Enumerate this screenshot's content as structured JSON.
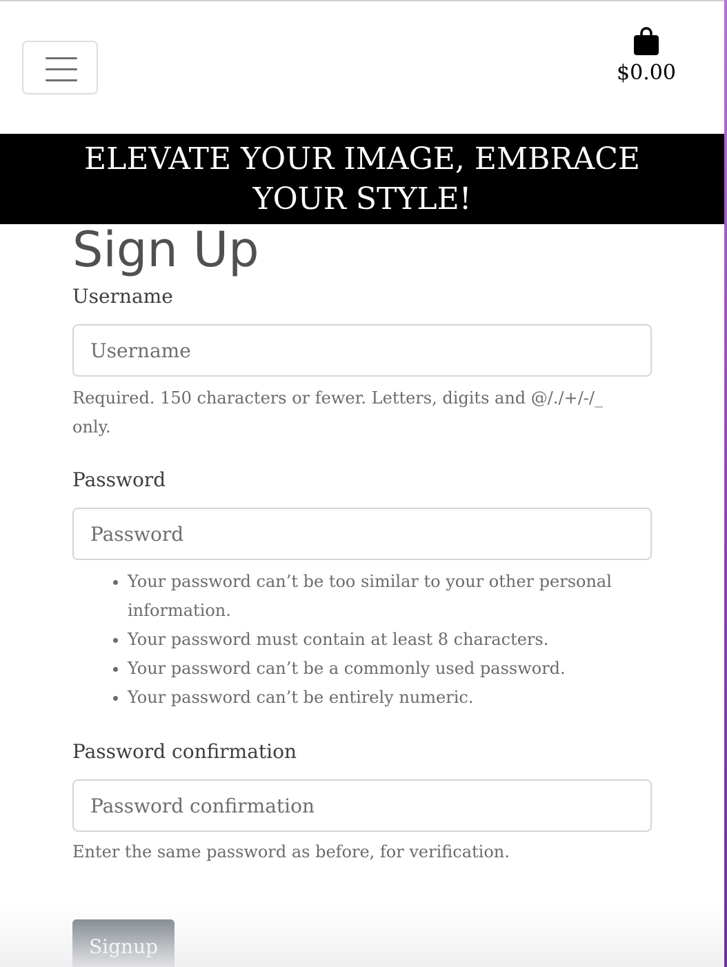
{
  "header": {
    "cart_total": "$0.00"
  },
  "banner": {
    "text": "ELEVATE YOUR IMAGE, EMBRACE YOUR STYLE!"
  },
  "form": {
    "title": "Sign Up",
    "username": {
      "label": "Username",
      "placeholder": "Username",
      "help": "Required. 150 characters or fewer. Letters, digits and @/./+/-/_ only."
    },
    "password": {
      "label": "Password",
      "placeholder": "Password",
      "help_items": [
        "Your password can’t be too similar to your other personal information.",
        "Your password must contain at least 8 characters.",
        "Your password can’t be a commonly used password.",
        "Your password can’t be entirely numeric."
      ]
    },
    "password_confirmation": {
      "label": "Password confirmation",
      "placeholder": "Password confirmation",
      "help": "Enter the same password as before, for verification."
    },
    "submit_label": "Signup"
  },
  "colors": {
    "banner_bg": "#000000",
    "button_bg": "#6c757d",
    "side_gradient": "#8a3fb0"
  },
  "icons": {
    "menu": "hamburger-icon",
    "cart": "shopping-bag-icon"
  }
}
